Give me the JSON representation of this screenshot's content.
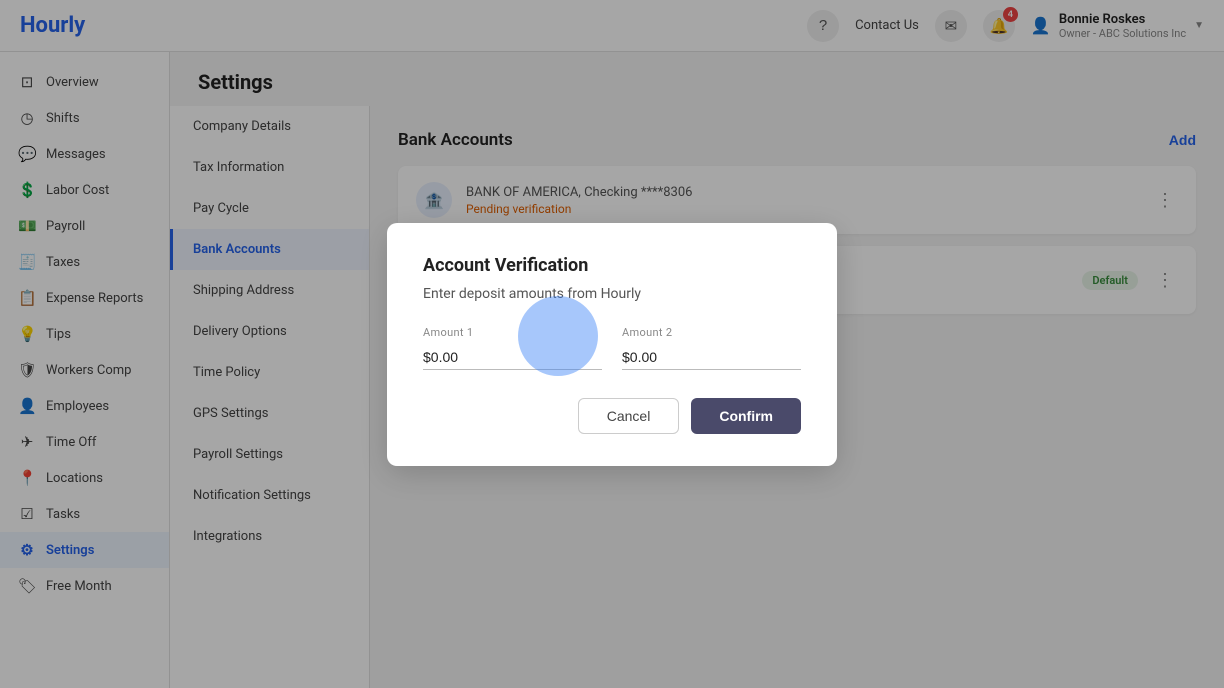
{
  "app": {
    "logo": "Hourly"
  },
  "header": {
    "contact_label": "Contact Us",
    "notification_count": "4",
    "user_name": "Bonnie Roskes",
    "user_role": "Owner - ABC Solutions Inc"
  },
  "sidebar": {
    "items": [
      {
        "id": "overview",
        "label": "Overview",
        "icon": "⊡"
      },
      {
        "id": "shifts",
        "label": "Shifts",
        "icon": "◷"
      },
      {
        "id": "messages",
        "label": "Messages",
        "icon": "💬"
      },
      {
        "id": "labor-cost",
        "label": "Labor Cost",
        "icon": "💲"
      },
      {
        "id": "payroll",
        "label": "Payroll",
        "icon": "💵"
      },
      {
        "id": "taxes",
        "label": "Taxes",
        "icon": "🧾"
      },
      {
        "id": "expense-reports",
        "label": "Expense Reports",
        "icon": "📋"
      },
      {
        "id": "tips",
        "label": "Tips",
        "icon": "💡"
      },
      {
        "id": "workers-comp",
        "label": "Workers Comp",
        "icon": "🛡"
      },
      {
        "id": "employees",
        "label": "Employees",
        "icon": "👤"
      },
      {
        "id": "time-off",
        "label": "Time Off",
        "icon": "✈"
      },
      {
        "id": "locations",
        "label": "Locations",
        "icon": "📍"
      },
      {
        "id": "tasks",
        "label": "Tasks",
        "icon": "☑"
      },
      {
        "id": "settings",
        "label": "Settings",
        "icon": "⚙"
      },
      {
        "id": "free-month",
        "label": "Free Month",
        "icon": "🏷"
      }
    ]
  },
  "settings": {
    "page_title": "Settings",
    "menu": [
      {
        "id": "company-details",
        "label": "Company Details"
      },
      {
        "id": "tax-information",
        "label": "Tax Information"
      },
      {
        "id": "pay-cycle",
        "label": "Pay Cycle"
      },
      {
        "id": "bank-accounts",
        "label": "Bank Accounts",
        "active": true
      },
      {
        "id": "shipping-address",
        "label": "Shipping Address"
      },
      {
        "id": "delivery-options",
        "label": "Delivery Options"
      },
      {
        "id": "time-policy",
        "label": "Time Policy"
      },
      {
        "id": "gps-settings",
        "label": "GPS Settings"
      },
      {
        "id": "payroll-settings",
        "label": "Payroll Settings"
      },
      {
        "id": "notification-settings",
        "label": "Notification Settings"
      },
      {
        "id": "integrations",
        "label": "Integrations"
      }
    ],
    "content": {
      "section_title": "Bank Accounts",
      "add_label": "Add",
      "accounts": [
        {
          "id": "boa",
          "bank_name": "BANK OF AMERICA",
          "account_type": ", Checking ****8306",
          "status": "Pending verification",
          "is_default": false
        },
        {
          "id": "default-account",
          "bank_name": "",
          "account_type": "",
          "status": "",
          "is_default": true,
          "default_label": "Default"
        }
      ]
    }
  },
  "modal": {
    "title": "Account Verification",
    "description": "Enter deposit amounts from Hourly",
    "amount1_label": "Amount 1",
    "amount1_value": "$0.00",
    "amount2_label": "Amount 2",
    "amount2_value": "$0.00",
    "cancel_label": "Cancel",
    "confirm_label": "Confirm"
  }
}
